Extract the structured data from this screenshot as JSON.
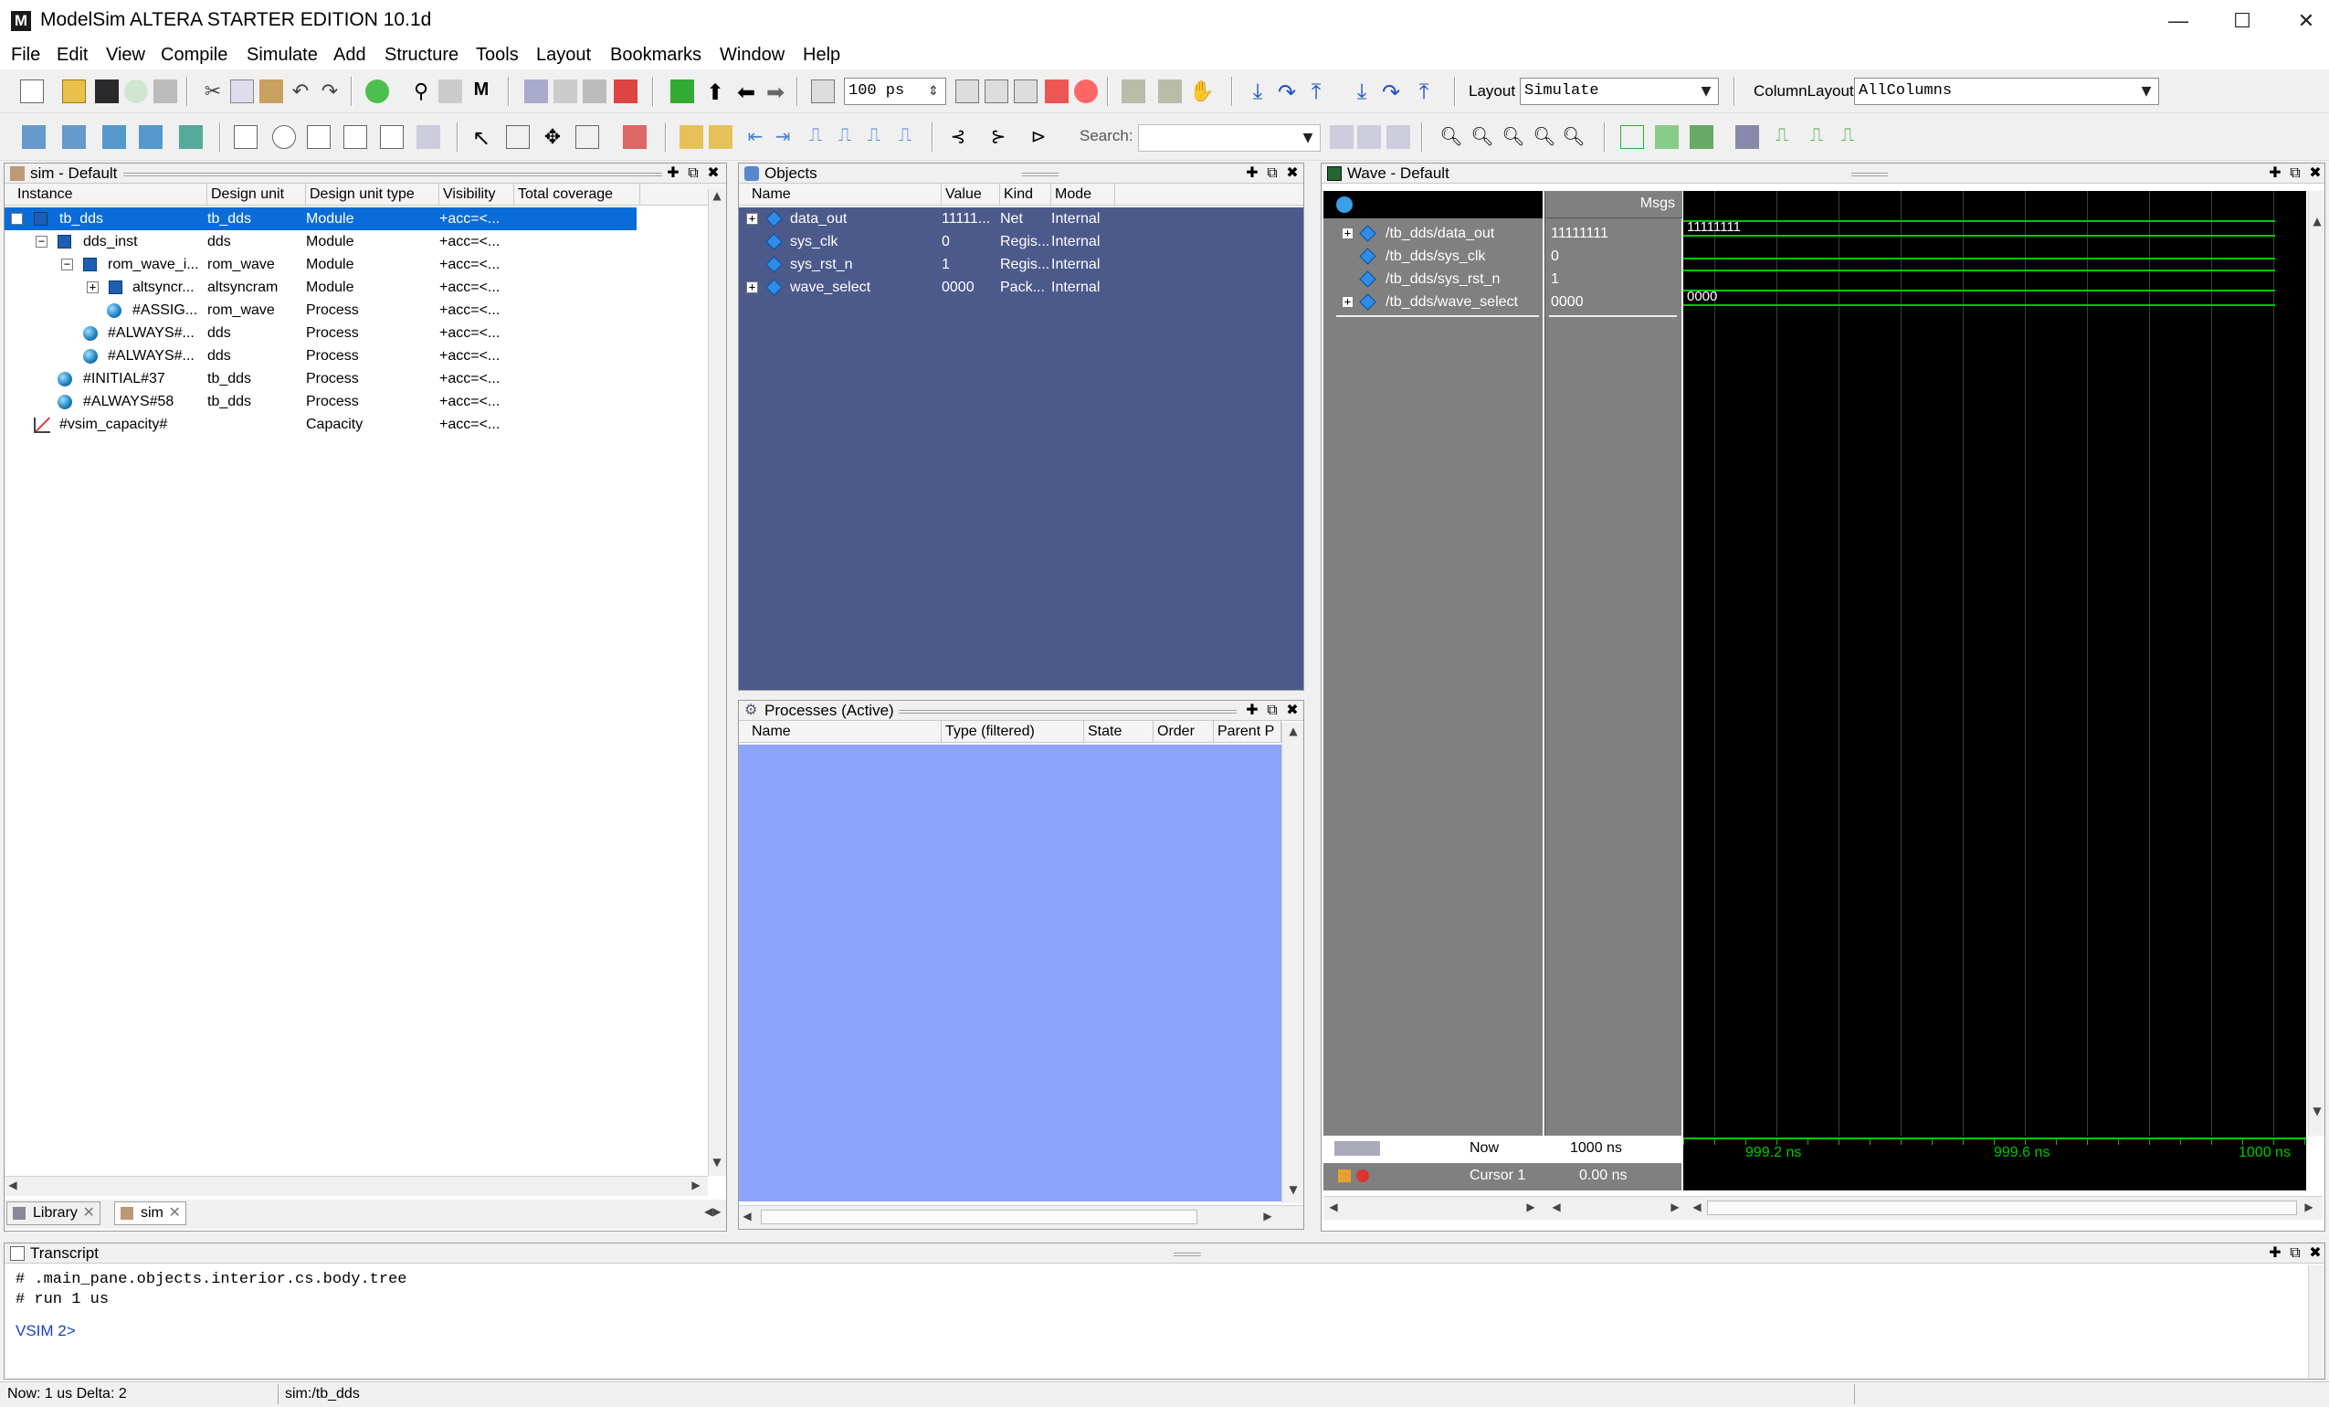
{
  "window": {
    "title": "ModelSim ALTERA STARTER EDITION 10.1d",
    "app_icon": "M",
    "minimize": "—",
    "maximize": "☐",
    "close": "✕"
  },
  "menu": [
    "File",
    "Edit",
    "View",
    "Compile",
    "Simulate",
    "Add",
    "Structure",
    "Tools",
    "Layout",
    "Bookmarks",
    "Window",
    "Help"
  ],
  "toolbar": {
    "run_length": "100 ps",
    "layout_label": "Layout",
    "layout_value": "Simulate",
    "column_layout_label": "ColumnLayout",
    "column_layout_value": "AllColumns",
    "search_label": "Search:",
    "search_value": ""
  },
  "sim_panel": {
    "title": "sim - Default",
    "columns": [
      "Instance",
      "Design unit",
      "Design unit type",
      "Visibility",
      "Total coverage"
    ],
    "rows": [
      {
        "instance": "tb_dds",
        "unit": "tb_dds",
        "type": "Module",
        "vis": "+acc=<..."
      },
      {
        "instance": "dds_inst",
        "unit": "dds",
        "type": "Module",
        "vis": "+acc=<..."
      },
      {
        "instance": "rom_wave_i...",
        "unit": "rom_wave",
        "type": "Module",
        "vis": "+acc=<..."
      },
      {
        "instance": "altsyncr...",
        "unit": "altsyncram",
        "type": "Module",
        "vis": "+acc=<..."
      },
      {
        "instance": "#ASSIG...",
        "unit": "rom_wave",
        "type": "Process",
        "vis": "+acc=<..."
      },
      {
        "instance": "#ALWAYS#...",
        "unit": "dds",
        "type": "Process",
        "vis": "+acc=<..."
      },
      {
        "instance": "#ALWAYS#...",
        "unit": "dds",
        "type": "Process",
        "vis": "+acc=<..."
      },
      {
        "instance": "#INITIAL#37",
        "unit": "tb_dds",
        "type": "Process",
        "vis": "+acc=<..."
      },
      {
        "instance": "#ALWAYS#58",
        "unit": "tb_dds",
        "type": "Process",
        "vis": "+acc=<..."
      },
      {
        "instance": "#vsim_capacity#",
        "unit": "",
        "type": "Capacity",
        "vis": "+acc=<..."
      }
    ],
    "tabs": [
      "Library",
      "sim"
    ]
  },
  "objects_panel": {
    "title": "Objects",
    "columns": [
      "Name",
      "Value",
      "Kind",
      "Mode"
    ],
    "rows": [
      {
        "name": "data_out",
        "value": "11111...",
        "kind": "Net",
        "mode": "Internal"
      },
      {
        "name": "sys_clk",
        "value": "0",
        "kind": "Regis...",
        "mode": "Internal"
      },
      {
        "name": "sys_rst_n",
        "value": "1",
        "kind": "Regis...",
        "mode": "Internal"
      },
      {
        "name": "wave_select",
        "value": "0000",
        "kind": "Pack...",
        "mode": "Internal"
      }
    ]
  },
  "processes_panel": {
    "title": "Processes (Active)",
    "columns": [
      "Name",
      "Type (filtered)",
      "State",
      "Order",
      "Parent P"
    ]
  },
  "wave_panel": {
    "title": "Wave - Default",
    "msgs_label": "Msgs",
    "signals": [
      {
        "path": "/tb_dds/data_out",
        "value": "11111111",
        "wave_text": "11111111"
      },
      {
        "path": "/tb_dds/sys_clk",
        "value": "0",
        "wave_text": ""
      },
      {
        "path": "/tb_dds/sys_rst_n",
        "value": "1",
        "wave_text": ""
      },
      {
        "path": "/tb_dds/wave_select",
        "value": "0000",
        "wave_text": "0000"
      }
    ],
    "now_label": "Now",
    "now_value": "1000 ns",
    "cursor_label": "Cursor 1",
    "cursor_value": "0.00 ns",
    "time_ticks": [
      "999.2 ns",
      "999.6 ns",
      "1000 ns"
    ]
  },
  "transcript": {
    "title": "Transcript",
    "lines": [
      "# .main_pane.objects.interior.cs.body.tree",
      "# run 1 us"
    ],
    "prompt": "VSIM 2>"
  },
  "statusbar": {
    "time": "Now: 1 us  Delta: 2",
    "context": "sim:/tb_dds"
  },
  "colors": {
    "objects_bg": "#4c5a8b",
    "processes_bg": "#8da4fb",
    "wave_bg": "#000000",
    "signal_green": "#00c800",
    "selection": "#0a6cd8"
  }
}
